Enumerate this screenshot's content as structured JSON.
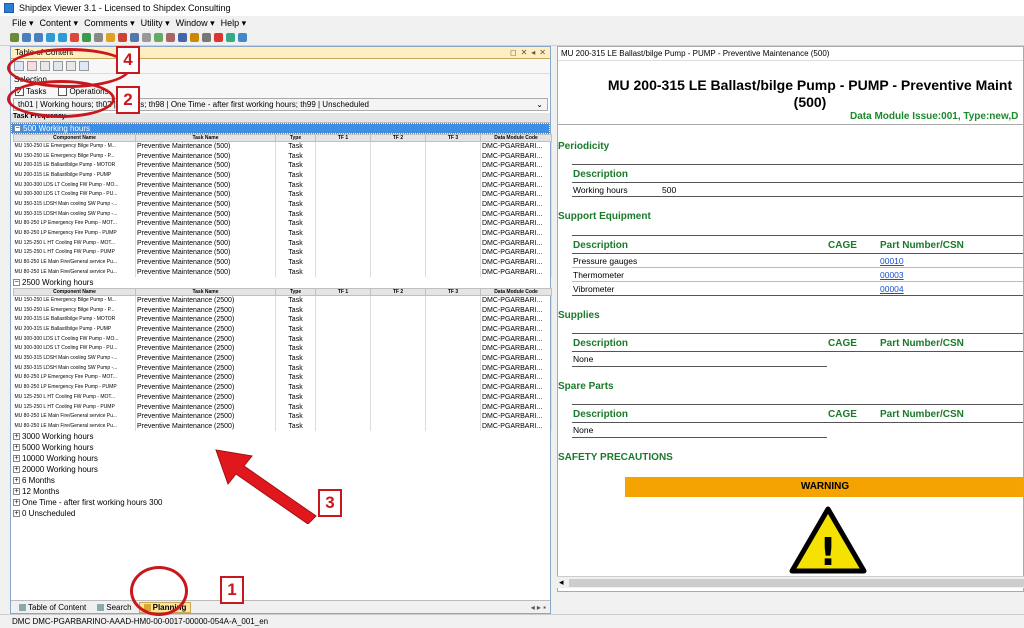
{
  "window": {
    "title": "Shipdex Viewer 3.1  -  Licensed to Shipdex Consulting"
  },
  "menu": [
    "File ▾",
    "Content ▾",
    "Comments ▾",
    "Utility ▾",
    "Window ▾",
    "Help ▾"
  ],
  "toc": {
    "panel_title": "Table of Content",
    "panel_buttons": [
      "◻",
      "✕",
      "◂",
      "✕"
    ],
    "selection_label": "Selection",
    "checkboxes": [
      {
        "label": "Tasks",
        "checked": true
      },
      {
        "label": "Operations",
        "checked": false
      }
    ],
    "filter_text": "th01 | Working hours; th02 | Months; th98 | One Time - after first working hours; th99 | Unscheduled",
    "tree_header": "Task Frequency",
    "columns": [
      "Component Name",
      "Task Name",
      "Type",
      "TF 1",
      "TF 2",
      "TF 3",
      "Data Module Code"
    ],
    "groups_expanded": [
      {
        "label": "500 Working hours",
        "expand": "−",
        "rows": [
          [
            "MU 150-250 LE Emergency Bilge Pump - M...",
            "Preventive Maintenance (500)",
            "Task",
            "",
            "",
            "",
            "DMC-PGARBARI..."
          ],
          [
            "MU 150-250 LE Emergency Bilge Pump - P...",
            "Preventive Maintenance (500)",
            "Task",
            "",
            "",
            "",
            "DMC-PGARBARI..."
          ],
          [
            "MU 200-315 LE Ballast/bilge Pump - MOTOR",
            "Preventive Maintenance (500)",
            "Task",
            "",
            "",
            "",
            "DMC-PGARBARI..."
          ],
          [
            "MU 200-315 LE Ballast/bilge Pump - PUMP",
            "Preventive Maintenance (500)",
            "Task",
            "",
            "",
            "",
            "DMC-PGARBARI..."
          ],
          [
            "MU 300-300 LDS LT Cooling FW Pump - MO...",
            "Preventive Maintenance (500)",
            "Task",
            "",
            "",
            "",
            "DMC-PGARBARI..."
          ],
          [
            "MU 300-300 LDS LT Cooling FW Pump - PU...",
            "Preventive Maintenance (500)",
            "Task",
            "",
            "",
            "",
            "DMC-PGARBARI..."
          ],
          [
            "MU 350-315 LDSH Main cooling SW Pump -...",
            "Preventive Maintenance (500)",
            "Task",
            "",
            "",
            "",
            "DMC-PGARBARI..."
          ],
          [
            "MU 350-315 LDSH Main cooling SW Pump -...",
            "Preventive Maintenance (500)",
            "Task",
            "",
            "",
            "",
            "DMC-PGARBARI..."
          ],
          [
            "MU 80-250 LP Emergency Fire Pump - MOT...",
            "Preventive Maintenance (500)",
            "Task",
            "",
            "",
            "",
            "DMC-PGARBARI..."
          ],
          [
            "MU 80-250 LP Emergency Fire Pump - PUMP",
            "Preventive Maintenance (500)",
            "Task",
            "",
            "",
            "",
            "DMC-PGARBARI..."
          ],
          [
            "MU 125-250 L HT Cooling FW Pump - MOT...",
            "Preventive Maintenance (500)",
            "Task",
            "",
            "",
            "",
            "DMC-PGARBARI..."
          ],
          [
            "MU 125-250 L HT Cooling FW Pump - PUMP",
            "Preventive Maintenance (500)",
            "Task",
            "",
            "",
            "",
            "DMC-PGARBARI..."
          ],
          [
            "MU 80-250 LE Main Fire/General service Pu...",
            "Preventive Maintenance (500)",
            "Task",
            "",
            "",
            "",
            "DMC-PGARBARI..."
          ],
          [
            "MU 80-250 LE Main Fire/General service Pu...",
            "Preventive Maintenance (500)",
            "Task",
            "",
            "",
            "",
            "DMC-PGARBARI..."
          ]
        ]
      },
      {
        "label": "2500 Working hours",
        "expand": "−",
        "rows": [
          [
            "MU 150-250 LE Emergency Bilge Pump - M...",
            "Preventive Maintenance (2500)",
            "Task",
            "",
            "",
            "",
            "DMC-PGARBARI..."
          ],
          [
            "MU 150-250 LE Emergency Bilge Pump - P...",
            "Preventive Maintenance (2500)",
            "Task",
            "",
            "",
            "",
            "DMC-PGARBARI..."
          ],
          [
            "MU 200-315 LE Ballast/bilge Pump - MOTOR",
            "Preventive Maintenance (2500)",
            "Task",
            "",
            "",
            "",
            "DMC-PGARBARI..."
          ],
          [
            "MU 200-315 LE Ballast/bilge Pump - PUMP",
            "Preventive Maintenance (2500)",
            "Task",
            "",
            "",
            "",
            "DMC-PGARBARI..."
          ],
          [
            "MU 300-300 LDS LT Cooling FW Pump - MO...",
            "Preventive Maintenance (2500)",
            "Task",
            "",
            "",
            "",
            "DMC-PGARBARI..."
          ],
          [
            "MU 300-300 LDS LT Cooling FW Pump - PU...",
            "Preventive Maintenance (2500)",
            "Task",
            "",
            "",
            "",
            "DMC-PGARBARI..."
          ],
          [
            "MU 350-315 LDSH Main cooling SW Pump -...",
            "Preventive Maintenance (2500)",
            "Task",
            "",
            "",
            "",
            "DMC-PGARBARI..."
          ],
          [
            "MU 350-315 LDSH Main cooling SW Pump -...",
            "Preventive Maintenance (2500)",
            "Task",
            "",
            "",
            "",
            "DMC-PGARBARI..."
          ],
          [
            "MU 80-250 LP Emergency Fire Pump - MOT...",
            "Preventive Maintenance (2500)",
            "Task",
            "",
            "",
            "",
            "DMC-PGARBARI..."
          ],
          [
            "MU 80-250 LP Emergency Fire Pump - PUMP",
            "Preventive Maintenance (2500)",
            "Task",
            "",
            "",
            "",
            "DMC-PGARBARI..."
          ],
          [
            "MU 125-250 L HT Cooling FW Pump - MOT...",
            "Preventive Maintenance (2500)",
            "Task",
            "",
            "",
            "",
            "DMC-PGARBARI..."
          ],
          [
            "MU 125-250 L HT Cooling FW Pump - PUMP",
            "Preventive Maintenance (2500)",
            "Task",
            "",
            "",
            "",
            "DMC-PGARBARI..."
          ],
          [
            "MU 80-250 LE Main Fire/General service Pu...",
            "Preventive Maintenance (2500)",
            "Task",
            "",
            "",
            "",
            "DMC-PGARBARI..."
          ],
          [
            "MU 80-250 LE Main Fire/General service Pu...",
            "Preventive Maintenance (2500)",
            "Task",
            "",
            "",
            "",
            "DMC-PGARBARI..."
          ]
        ]
      }
    ],
    "groups_collapsed": [
      "3000 Working hours",
      "5000 Working hours",
      "10000 Working hours",
      "20000 Working hours",
      "6 Months",
      "12 Months",
      "One Time - after first working hours 300",
      "0 Unscheduled"
    ],
    "collapsed_expand": "+",
    "bottom_tabs": [
      {
        "label": "Table of Content",
        "active": false
      },
      {
        "label": "Search",
        "active": false
      },
      {
        "label": "Planning",
        "active": true
      }
    ],
    "tab_nav": "◂ ▸ ▪"
  },
  "document": {
    "tab_title": "MU 200-315 LE Ballast/bilge Pump - PUMP - Preventive Maintenance (500)",
    "title_line1": "MU 200-315 LE Ballast/bilge Pump - PUMP - Preventive Maint",
    "title_line2": "(500)",
    "issue": "Data Module Issue:001, Type:new,D",
    "periodicity": {
      "heading": "Periodicity",
      "col": "Description",
      "row_label": "Working hours",
      "row_value": "500"
    },
    "support": {
      "heading": "Support Equipment",
      "cols": [
        "Description",
        "CAGE",
        "Part Number/CSN"
      ],
      "rows": [
        {
          "desc": "Pressure gauges",
          "pn": "00010"
        },
        {
          "desc": "Thermometer",
          "pn": "00003"
        },
        {
          "desc": "Vibrometer",
          "pn": "00004"
        }
      ]
    },
    "supplies": {
      "heading": "Supplies",
      "cols": [
        "Description",
        "CAGE",
        "Part Number/CSN"
      ],
      "row": "None"
    },
    "spares": {
      "heading": "Spare Parts",
      "cols": [
        "Description",
        "CAGE",
        "Part Number/CSN"
      ],
      "row": "None"
    },
    "safety": {
      "heading": "SAFETY PRECAUTIONS",
      "warning": "WARNING",
      "warning_symbol": "!"
    },
    "scroll_left": "◂"
  },
  "status": {
    "text": "DMC DMC-PGARBARINO-AAAD-HM0-00-0017-00000-054A-A_001_en"
  },
  "annotations": {
    "labels": [
      "1",
      "2",
      "3",
      "4"
    ],
    "color": "#c8171d"
  },
  "colors": {
    "accent": "#3d8ee6",
    "doc_green": "#1a7a2a",
    "warning": "#f4a300",
    "annotation": "#c8171d"
  }
}
